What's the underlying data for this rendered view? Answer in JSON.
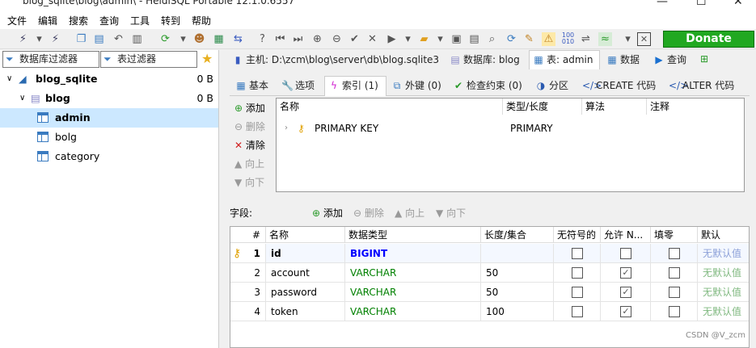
{
  "window": {
    "title": "blog_sqlite\\blog\\admin\\ - HeidiSQL Portable 12.1.0.6557",
    "min": "—",
    "max": "☐",
    "close": "✕"
  },
  "menu": [
    "文件",
    "编辑",
    "搜索",
    "查询",
    "工具",
    "转到",
    "帮助"
  ],
  "toolbar": {
    "donate_label": "Donate"
  },
  "left": {
    "db_filter": "数据库过滤器",
    "table_filter": "表过滤器",
    "tree": [
      {
        "label": "blog_sqlite",
        "size": "0 B"
      },
      {
        "label": "blog",
        "size": "0 B"
      },
      {
        "label": "admin",
        "size": ""
      },
      {
        "label": "bolg",
        "size": ""
      },
      {
        "label": "category",
        "size": ""
      }
    ]
  },
  "top_tabs": [
    {
      "label": "主机: D:\\zcm\\blog\\server\\db\\blog.sqlite3"
    },
    {
      "label": "数据库: blog"
    },
    {
      "label": "表: admin"
    },
    {
      "label": "数据"
    },
    {
      "label": "查询"
    }
  ],
  "sub_tabs": [
    {
      "label": "基本"
    },
    {
      "label": "选项"
    },
    {
      "label": "索引 (1)"
    },
    {
      "label": "外键 (0)"
    },
    {
      "label": "检查约束 (0)"
    },
    {
      "label": "分区"
    },
    {
      "label": "CREATE 代码"
    },
    {
      "label": "ALTER 代码"
    }
  ],
  "index_actions": {
    "add": "添加",
    "remove": "删除",
    "clear": "清除",
    "up": "向上",
    "down": "向下"
  },
  "index_grid": {
    "headers": [
      "名称",
      "类型/长度",
      "算法",
      "注释"
    ],
    "rows": [
      {
        "name": "PRIMARY KEY",
        "type": "PRIMARY",
        "algorithm": "",
        "comment": ""
      }
    ]
  },
  "fields": {
    "label": "字段:",
    "actions": {
      "add": "添加",
      "remove": "删除",
      "up": "向上",
      "down": "向下"
    },
    "headers": [
      "#",
      "名称",
      "数据类型",
      "长度/集合",
      "无符号的",
      "允许 N...",
      "填零",
      "默认"
    ],
    "rows": [
      {
        "num": "1",
        "name": "id",
        "type": "BIGINT",
        "length": "",
        "unsigned": false,
        "allow_null": false,
        "zerofill": false,
        "default": "无默认值"
      },
      {
        "num": "2",
        "name": "account",
        "type": "VARCHAR",
        "length": "50",
        "unsigned": false,
        "allow_null": true,
        "zerofill": false,
        "default": "无默认值"
      },
      {
        "num": "3",
        "name": "password",
        "type": "VARCHAR",
        "length": "50",
        "unsigned": false,
        "allow_null": true,
        "zerofill": false,
        "default": "无默认值"
      },
      {
        "num": "4",
        "name": "token",
        "type": "VARCHAR",
        "length": "100",
        "unsigned": false,
        "allow_null": true,
        "zerofill": false,
        "default": "无默认值"
      }
    ]
  },
  "watermark": "CSDN @V_zcm"
}
